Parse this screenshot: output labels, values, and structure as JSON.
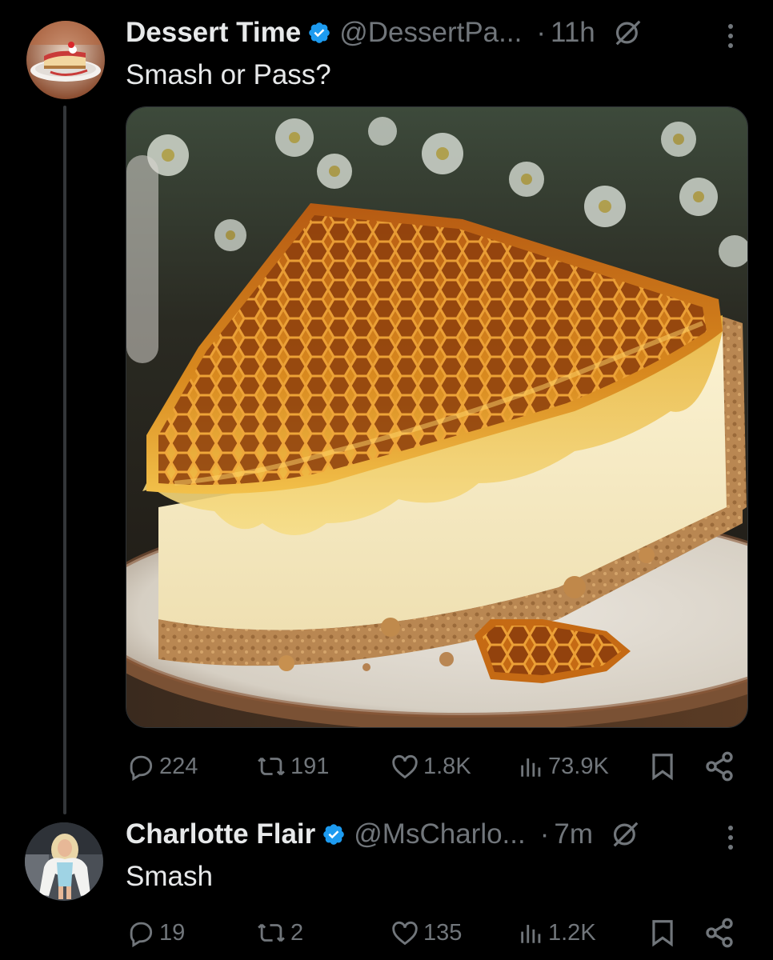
{
  "tweets": [
    {
      "author_name": "Dessert Time",
      "handle": "@DessertPa...",
      "separator": "·",
      "time": "11h",
      "text": "Smash or Pass?",
      "avatar_icon": "cheesecake-avatar",
      "media_icon": "honeycomb-cheesecake-photo",
      "replies": "224",
      "reposts": "191",
      "likes": "1.8K",
      "views": "73.9K"
    },
    {
      "author_name": "Charlotte Flair",
      "handle": "@MsCharlo...",
      "separator": "·",
      "time": "7m",
      "text": "Smash",
      "avatar_icon": "person-avatar",
      "replies": "19",
      "reposts": "2",
      "likes": "135",
      "views": "1.2K"
    }
  ],
  "colors": {
    "background": "#000000",
    "text": "#e7e9ea",
    "muted": "#71767b",
    "verified": "#1d9bf0",
    "divider": "#333639"
  }
}
